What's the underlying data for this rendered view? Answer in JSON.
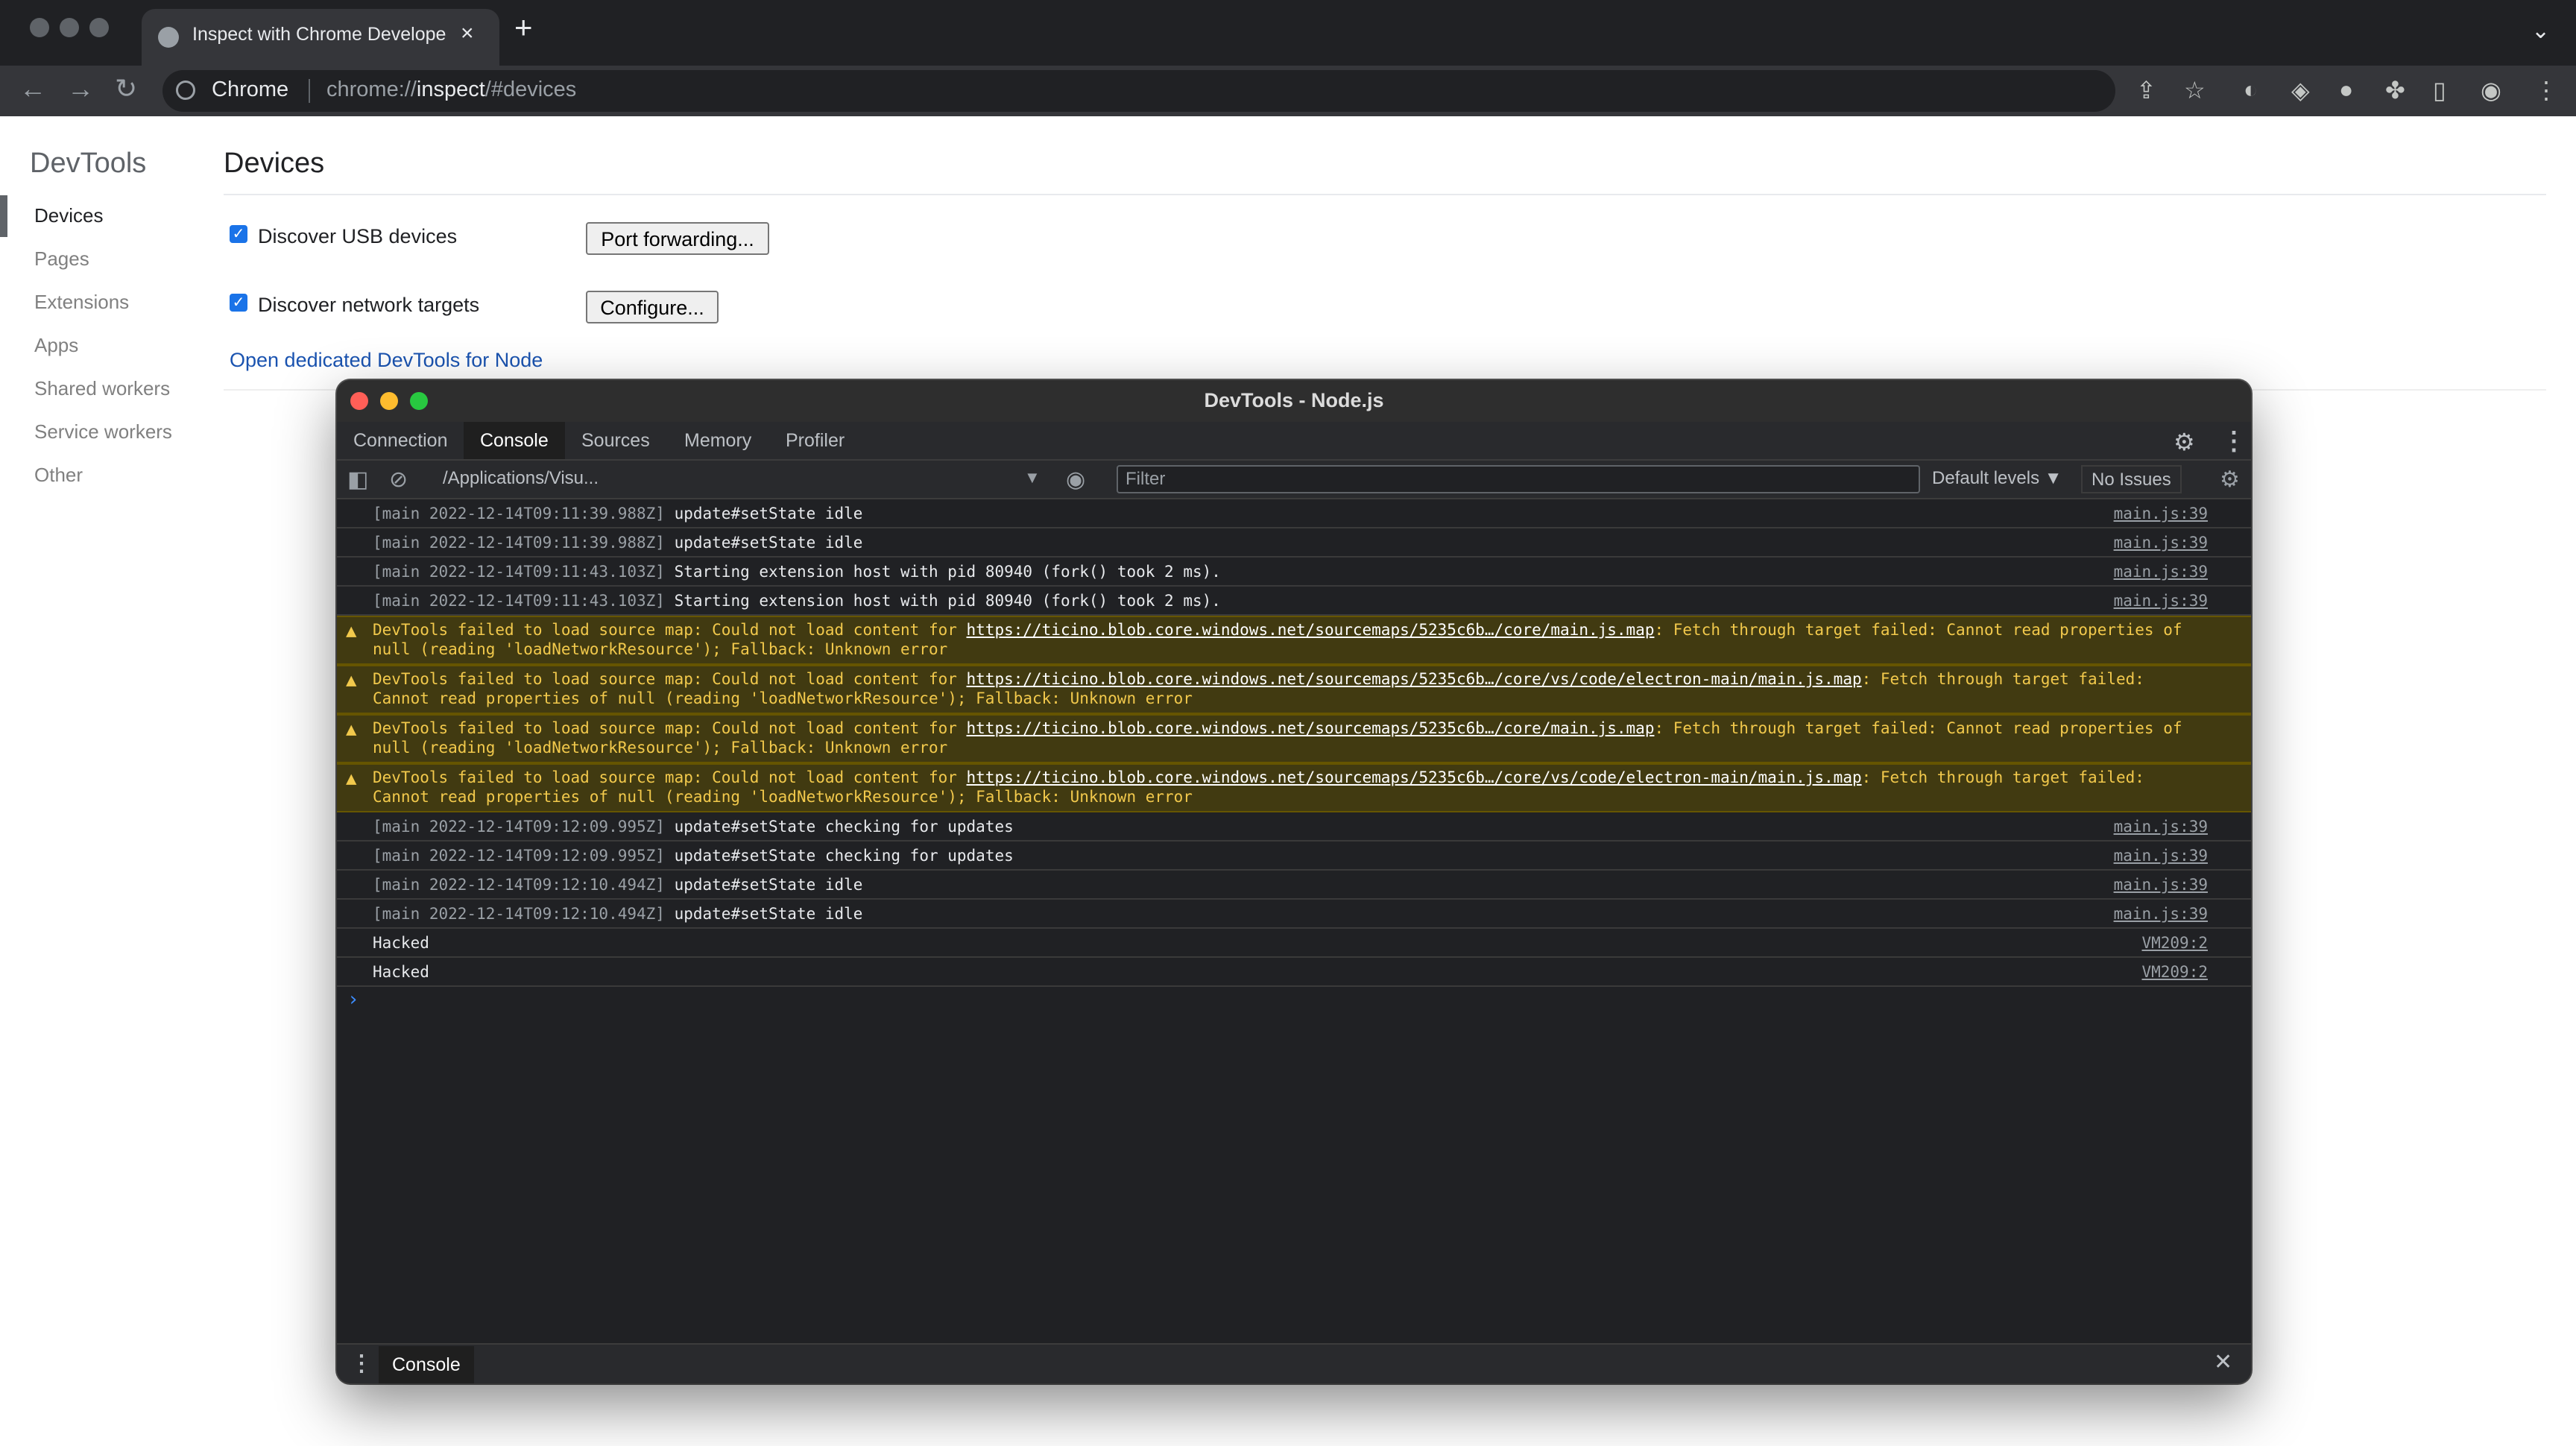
{
  "browser": {
    "tab_title": "Inspect with Chrome Developer Tools",
    "new_tab_symbol": "+",
    "tab_close_symbol": "×",
    "omnibox_chip": "Chrome",
    "url_scheme": "chrome://",
    "url_host": "inspect",
    "url_rest": "/#devices"
  },
  "inspect_page": {
    "sidebar_title": "DevTools",
    "nav_items": [
      "Devices",
      "Pages",
      "Extensions",
      "Apps",
      "Shared workers",
      "Service workers",
      "Other"
    ],
    "active_nav": "Devices",
    "page_title": "Devices",
    "discover_usb_label": "Discover USB devices",
    "discover_usb_checked": true,
    "port_forwarding_label": "Port forwarding...",
    "discover_network_label": "Discover network targets",
    "discover_network_checked": true,
    "configure_label": "Configure...",
    "node_link": "Open dedicated DevTools for Node"
  },
  "devtools": {
    "window_title": "DevTools - Node.js",
    "tabs": [
      "Connection",
      "Console",
      "Sources",
      "Memory",
      "Profiler"
    ],
    "active_tab": "Console",
    "context": "/Applications/Visu...",
    "filter_placeholder": "Filter",
    "levels_label": "Default levels ▼",
    "issues_label": "No Issues",
    "drawer_tab": "Console",
    "colors": {
      "warning_bg": "#413a11",
      "warning_text": "#f2c94c",
      "prompt": "#3c8dff"
    }
  },
  "console": {
    "log_top": [
      {
        "ts": "[main 2022-12-14T09:11:39.988Z]",
        "msg": "update#setState idle",
        "src": "main.js:39"
      },
      {
        "ts": "[main 2022-12-14T09:11:39.988Z]",
        "msg": "update#setState idle",
        "src": "main.js:39"
      },
      {
        "ts": "[main 2022-12-14T09:11:43.103Z]",
        "msg": "Starting extension host with pid 80940 (fork() took 2 ms).",
        "src": "main.js:39"
      },
      {
        "ts": "[main 2022-12-14T09:11:43.103Z]",
        "msg": "Starting extension host with pid 80940 (fork() took 2 ms).",
        "src": "main.js:39"
      }
    ],
    "warnings": [
      {
        "pre": "DevTools failed to load source map: Could not load content for ",
        "url": "https://ticino.blob.core.windows.net/sourcemaps/5235c6b…/core/main.js.map",
        "post": ": Fetch through target failed: Cannot read properties of null (reading 'loadNetworkResource'); Fallback: Unknown error"
      },
      {
        "pre": "DevTools failed to load source map: Could not load content for ",
        "url": "https://ticino.blob.core.windows.net/sourcemaps/5235c6b…/core/vs/code/electron-main/main.js.map",
        "post": ": Fetch through target failed: Cannot read properties of null (reading 'loadNetworkResource'); Fallback: Unknown error"
      },
      {
        "pre": "DevTools failed to load source map: Could not load content for ",
        "url": "https://ticino.blob.core.windows.net/sourcemaps/5235c6b…/core/main.js.map",
        "post": ": Fetch through target failed: Cannot read properties of null (reading 'loadNetworkResource'); Fallback: Unknown error"
      },
      {
        "pre": "DevTools failed to load source map: Could not load content for ",
        "url": "https://ticino.blob.core.windows.net/sourcemaps/5235c6b…/core/vs/code/electron-main/main.js.map",
        "post": ": Fetch through target failed: Cannot read properties of null (reading 'loadNetworkResource'); Fallback: Unknown error"
      }
    ],
    "log_bottom": [
      {
        "ts": "[main 2022-12-14T09:12:09.995Z]",
        "msg": "update#setState checking for updates",
        "src": "main.js:39"
      },
      {
        "ts": "[main 2022-12-14T09:12:09.995Z]",
        "msg": "update#setState checking for updates",
        "src": "main.js:39"
      },
      {
        "ts": "[main 2022-12-14T09:12:10.494Z]",
        "msg": "update#setState idle",
        "src": "main.js:39"
      },
      {
        "ts": "[main 2022-12-14T09:12:10.494Z]",
        "msg": "update#setState idle",
        "src": "main.js:39"
      },
      {
        "ts": "",
        "msg": "Hacked",
        "src": "VM209:2"
      },
      {
        "ts": "",
        "msg": "Hacked",
        "src": "VM209:2"
      }
    ],
    "prompt_symbol": "›"
  }
}
